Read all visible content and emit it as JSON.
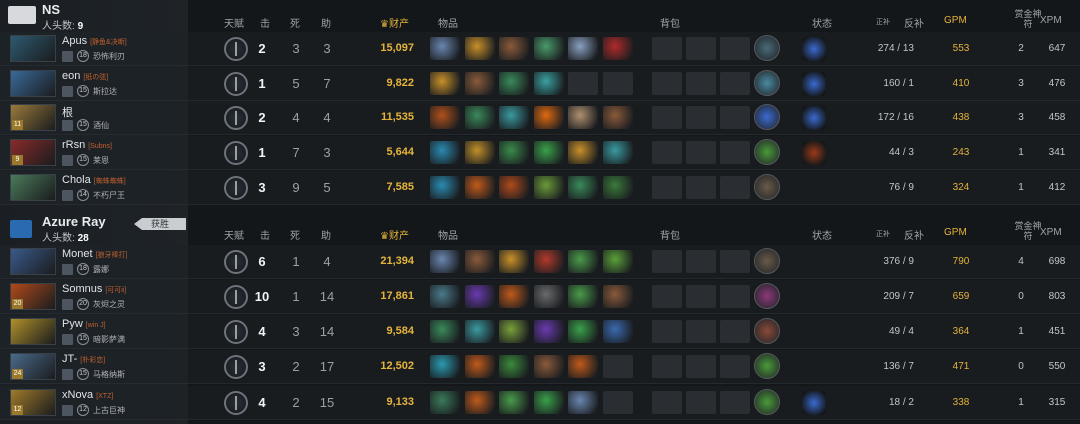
{
  "teams": [
    {
      "name": "NS",
      "kills_label": "人头数:",
      "kills": "9",
      "logo_color": "#d7d9dc",
      "header": {
        "talent": "天赋",
        "k": "击",
        "d": "死",
        "a": "助",
        "nw": "财产",
        "items": "物品",
        "backpack": "背包",
        "status": "状态",
        "lh_prefix": "正补",
        "lh": "反补",
        "gpm": "GPM",
        "bounty": "赏金神符",
        "xpm": "XPM"
      },
      "players": [
        {
          "name": "Apus",
          "guild": "[静鱼&决断]",
          "rank": "18",
          "hero": "恐怖利刃",
          "level": "",
          "portrait": "#2d5a70",
          "kills": "2",
          "deaths": "3",
          "assists": "3",
          "networth": "15,097",
          "items": [
            "#6a86b0",
            "#c8902a",
            "#8a5a3a",
            "#4a9a6a",
            "#8aa0c0",
            "#b02a2a"
          ],
          "neutral": "#4a6a78",
          "status": "#3a6ad0",
          "lh": "274",
          "dn": "13",
          "gpm": "553",
          "bounty": "2",
          "xpm": "647"
        },
        {
          "name": "eon",
          "guild": "[纸の弦]",
          "rank": "15",
          "hero": "斯拉达",
          "level": "",
          "portrait": "#3a6a9a",
          "kills": "1",
          "deaths": "5",
          "assists": "7",
          "networth": "9,822",
          "items": [
            "#c8902a",
            "#8a5a3a",
            "#3a8a5a",
            "#3aa0a0",
            "",
            ""
          ],
          "neutral": "#4a8aa0",
          "status": "#3a6ad0",
          "lh": "160",
          "dn": "1",
          "gpm": "410",
          "bounty": "3",
          "xpm": "476"
        },
        {
          "name": "根",
          "guild": "",
          "rank": "15",
          "hero": "酒仙",
          "level": "11",
          "portrait": "#9a7a3a",
          "kills": "2",
          "deaths": "4",
          "assists": "4",
          "networth": "11,535",
          "items": [
            "#b0501a",
            "#3a8a5a",
            "#3a9aa0",
            "#e06a10",
            "#b09070",
            "#8a5a3a"
          ],
          "neutral": "#3a6ad0",
          "status": "#3a6ad0",
          "lh": "172",
          "dn": "16",
          "gpm": "438",
          "bounty": "3",
          "xpm": "458"
        },
        {
          "name": "rRsn",
          "guild": "[Subns]",
          "rank": "15",
          "hero": "莱恩",
          "level": "9",
          "portrait": "#8a2a2a",
          "kills": "1",
          "deaths": "7",
          "assists": "3",
          "networth": "5,644",
          "items": [
            "#2a8ab0",
            "#c0902a",
            "#3a8a4a",
            "#3aa04a",
            "#c8902a",
            "#3a9aa0"
          ],
          "neutral": "#4a9a3a",
          "status": "#9a3a1a",
          "lh": "44",
          "dn": "3",
          "gpm": "243",
          "bounty": "1",
          "xpm": "341"
        },
        {
          "name": "Chola",
          "guild": "[蜘蛛蜘蛛]",
          "rank": "14",
          "hero": "不朽尸王",
          "level": "",
          "portrait": "#4a7a5a",
          "kills": "3",
          "deaths": "9",
          "assists": "5",
          "networth": "7,585",
          "items": [
            "#2a8ab0",
            "#c05a1a",
            "#b04a1a",
            "#6a9a3a",
            "#3a8a5a",
            "#3a7a3a"
          ],
          "neutral": "#6a5a4a",
          "status": "",
          "lh": "76",
          "dn": "9",
          "gpm": "324",
          "bounty": "1",
          "xpm": "412"
        }
      ]
    },
    {
      "name": "Azure Ray",
      "kills_label": "人头数:",
      "kills": "28",
      "logo_color": "#2a6ab0",
      "win_label": "获胜",
      "header": {
        "talent": "天赋",
        "k": "击",
        "d": "死",
        "a": "助",
        "nw": "财产",
        "items": "物品",
        "backpack": "背包",
        "status": "状态",
        "lh_prefix": "正补",
        "lh": "反补",
        "gpm": "GPM",
        "bounty": "赏金神符",
        "xpm": "XPM"
      },
      "players": [
        {
          "name": "Monet",
          "guild": "[狼牙棒打]",
          "rank": "18",
          "hero": "露娜",
          "level": "",
          "portrait": "#3a5a8a",
          "kills": "6",
          "deaths": "1",
          "assists": "4",
          "networth": "21,394",
          "items": [
            "#6a86b0",
            "#8a5a3a",
            "#c8902a",
            "#b03a2a",
            "#4a9a4a",
            "#5aa03a"
          ],
          "neutral": "#6a5a4a",
          "status": "",
          "lh": "376",
          "dn": "9",
          "gpm": "790",
          "bounty": "4",
          "xpm": "698"
        },
        {
          "name": "Somnus",
          "guild": "[可可ii]",
          "rank": "20",
          "hero": "灰烬之灵",
          "level": "20",
          "portrait": "#b04a1a",
          "kills": "10",
          "deaths": "1",
          "assists": "14",
          "networth": "17,861",
          "items": [
            "#4a7a8a",
            "#6a3ab0",
            "#c05a1a",
            "#6a6a6a",
            "#4a9a4a",
            "#8a5a3a"
          ],
          "neutral": "#8a3a7a",
          "status": "",
          "lh": "209",
          "dn": "7",
          "gpm": "659",
          "bounty": "0",
          "xpm": "803"
        },
        {
          "name": "Pyw",
          "guild": "[win J]",
          "rank": "15",
          "hero": "暗影萨满",
          "level": "",
          "portrait": "#b0902a",
          "kills": "4",
          "deaths": "3",
          "assists": "14",
          "networth": "9,584",
          "items": [
            "#3a8a5a",
            "#3a9aa0",
            "#7aa03a",
            "#6a3ab0",
            "#3aa04a",
            "#3a6ab0"
          ],
          "neutral": "#8a4a3a",
          "status": "",
          "lh": "49",
          "dn": "4",
          "gpm": "364",
          "bounty": "1",
          "xpm": "451"
        },
        {
          "name": "JT-",
          "guild": "[朴彩恋]",
          "rank": "15",
          "hero": "马格纳斯",
          "level": "24",
          "portrait": "#4a6a8a",
          "kills": "3",
          "deaths": "2",
          "assists": "17",
          "networth": "12,502",
          "items": [
            "#2a9ab0",
            "#c05a1a",
            "#3a8a3a",
            "#8a5a3a",
            "#c05a1a",
            ""
          ],
          "neutral": "#4a9a3a",
          "status": "",
          "lh": "136",
          "dn": "7",
          "gpm": "471",
          "bounty": "0",
          "xpm": "550"
        },
        {
          "name": "xNova",
          "guild": "[XTZ]",
          "rank": "12",
          "hero": "上古巨神",
          "level": "12",
          "portrait": "#a07a2a",
          "kills": "4",
          "deaths": "2",
          "assists": "15",
          "networth": "9,133",
          "items": [
            "#3a7a5a",
            "#c05a1a",
            "#4a9a4a",
            "#3aa04a",
            "#6a86b0",
            ""
          ],
          "neutral": "#4a9a3a",
          "status": "#3a6ad0",
          "lh": "18",
          "dn": "2",
          "gpm": "338",
          "bounty": "1",
          "xpm": "315"
        }
      ]
    }
  ]
}
